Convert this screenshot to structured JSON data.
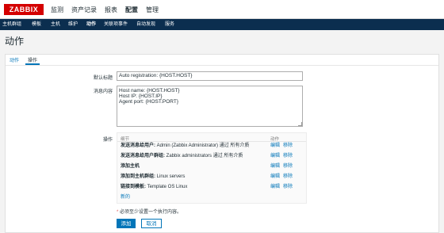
{
  "logo": "ZABBIX",
  "top_nav": [
    "监测",
    "资产记录",
    "报表",
    "配置",
    "管理"
  ],
  "sub_nav": [
    "主机群组",
    "模板",
    "主机",
    "维护",
    "动作",
    "关联项事件",
    "自动发现",
    "服务"
  ],
  "page_title": "动作",
  "tabs": [
    "动作",
    "操作"
  ],
  "form": {
    "subject_label": "默认标题",
    "subject_value": "Auto registration: {HOST.HOST}",
    "message_label": "消息内容",
    "message_value": "Host name: {HOST.HOST}\nHost IP: {HOST.IP}\nAgent port: {HOST.PORT}",
    "operations_label": "操作",
    "operations": {
      "col_details": "细节",
      "col_action": "动作",
      "rows": [
        {
          "bold": "发送消息给用户:",
          "text": " Admin (Zabbix Administrator) 通过 所有介质",
          "edit": "编辑",
          "remove": "移除"
        },
        {
          "bold": "发送消息给用户群组:",
          "text": " Zabbix administrators 通过 所有介质",
          "edit": "编辑",
          "remove": "移除"
        },
        {
          "bold": "添加主机",
          "text": "",
          "edit": "编辑",
          "remove": "移除"
        },
        {
          "bold": "添加到主机群组:",
          "text": " Linux servers",
          "edit": "编辑",
          "remove": "移除"
        },
        {
          "bold": "链接到模板:",
          "text": " Template OS Linux",
          "edit": "编辑",
          "remove": "移除"
        }
      ],
      "new_link": "新的"
    },
    "note_star": "*",
    "note_text": " 必须至少设置一个执行内容。",
    "add_button": "添加",
    "cancel_button": "取消"
  },
  "colors": {
    "brand": "#d40000",
    "accent": "#0275b8",
    "subnav_bg": "#0b2e4f"
  }
}
